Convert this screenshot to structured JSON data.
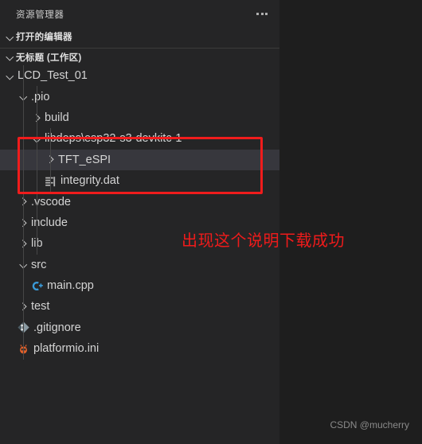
{
  "sidebar": {
    "title": "资源管理器",
    "more_icon": "ellipsis-icon",
    "sections": [
      {
        "label": "打开的编辑器",
        "expanded": true
      },
      {
        "label": "无标题 (工作区)",
        "expanded": true
      }
    ],
    "tree": [
      {
        "label": "LCD_Test_01",
        "type": "folder",
        "expanded": true,
        "indent": 1,
        "icon": "chevron-down-icon"
      },
      {
        "label": ".pio",
        "type": "folder",
        "expanded": true,
        "indent": 2,
        "icon": "chevron-down-icon"
      },
      {
        "label": "build",
        "type": "folder",
        "expanded": false,
        "indent": 3,
        "icon": "chevron-right-icon"
      },
      {
        "label": "libdeps\\esp32-s3-devkitc-1",
        "type": "folder",
        "expanded": true,
        "indent": 3,
        "icon": "chevron-down-icon"
      },
      {
        "label": "TFT_eSPI",
        "type": "folder",
        "expanded": false,
        "indent": 4,
        "icon": "chevron-right-icon",
        "selected": true
      },
      {
        "label": "integrity.dat",
        "type": "file",
        "indent": 4,
        "icon": "dat-file-icon"
      },
      {
        "label": ".vscode",
        "type": "folder",
        "expanded": false,
        "indent": 2,
        "icon": "chevron-right-icon"
      },
      {
        "label": "include",
        "type": "folder",
        "expanded": false,
        "indent": 2,
        "icon": "chevron-right-icon"
      },
      {
        "label": "lib",
        "type": "folder",
        "expanded": false,
        "indent": 2,
        "icon": "chevron-right-icon"
      },
      {
        "label": "src",
        "type": "folder",
        "expanded": true,
        "indent": 2,
        "icon": "chevron-down-icon"
      },
      {
        "label": "main.cpp",
        "type": "file",
        "indent": 3,
        "icon": "cpp-file-icon"
      },
      {
        "label": "test",
        "type": "folder",
        "expanded": false,
        "indent": 2,
        "icon": "chevron-right-icon"
      },
      {
        "label": ".gitignore",
        "type": "file",
        "indent": 2,
        "icon": "git-file-icon"
      },
      {
        "label": "platformio.ini",
        "type": "file",
        "indent": 2,
        "icon": "platformio-file-icon"
      }
    ]
  },
  "annotation": {
    "text": "出现这个说明下载成功",
    "color": "#ef1b1b"
  },
  "watermark": {
    "text": "CSDN @mucherry"
  },
  "colors": {
    "sidebar_bg": "#252526",
    "editor_bg": "#1e1e1e",
    "selection_bg": "#37373d",
    "highlight_border": "#f01c1c",
    "text": "#cccccc"
  }
}
